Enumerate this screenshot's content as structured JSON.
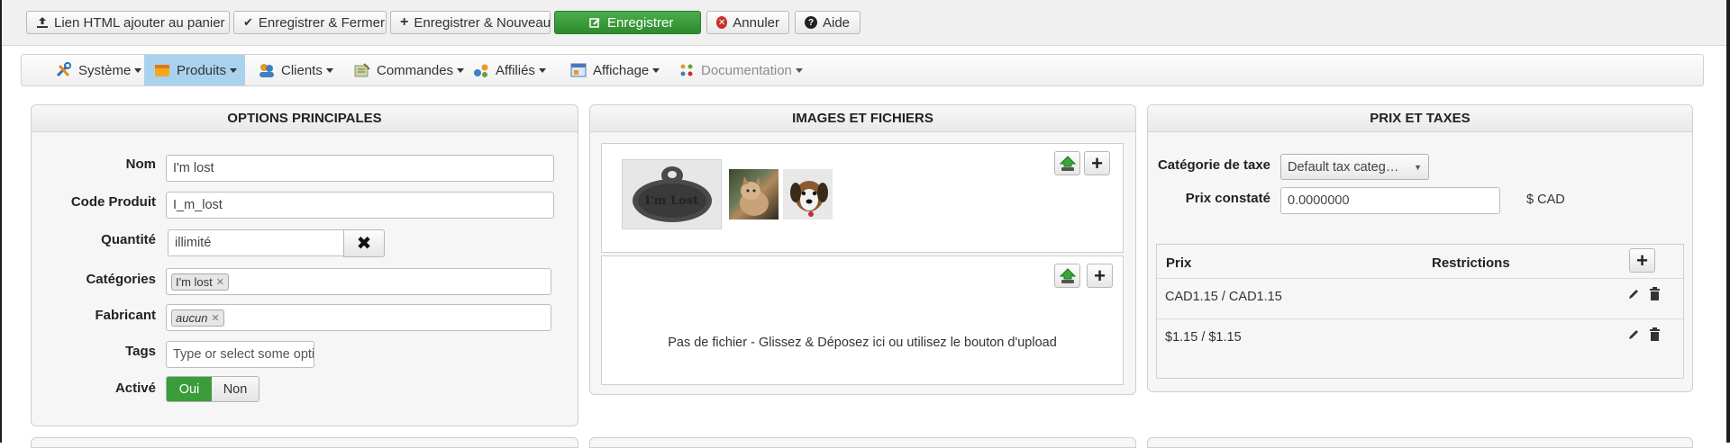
{
  "toolbar": {
    "link_html": "Lien HTML ajouter au panier",
    "save_close": "Enregistrer & Fermer",
    "save_new": "Enregistrer & Nouveau",
    "save": "Enregistrer",
    "cancel": "Annuler",
    "help": "Aide"
  },
  "nav": {
    "items": [
      {
        "label": "Système",
        "icon": "wrench-screwdriver-icon"
      },
      {
        "label": "Produits",
        "icon": "box-icon"
      },
      {
        "label": "Clients",
        "icon": "users-icon"
      },
      {
        "label": "Commandes",
        "icon": "orders-icon"
      },
      {
        "label": "Affiliés",
        "icon": "affiliates-icon"
      },
      {
        "label": "Affichage",
        "icon": "display-icon"
      },
      {
        "label": "Documentation",
        "icon": "documentation-icon"
      }
    ],
    "active_index": 1,
    "active_color": "#a9d2ef"
  },
  "main_options": {
    "title": "OPTIONS PRINCIPALES",
    "name_label": "Nom",
    "name_value": "I'm lost",
    "code_label": "Code Produit",
    "code_value": "I_m_lost",
    "quantity_label": "Quantité",
    "quantity_value": "illimité",
    "categories_label": "Catégories",
    "categories": [
      "I'm lost"
    ],
    "manufacturer_label": "Fabricant",
    "manufacturer": "aucun",
    "tags_label": "Tags",
    "tags_placeholder": "Type or select some opti",
    "active_label": "Activé",
    "active_yes": "Oui",
    "active_no": "Non",
    "active_state": "Oui"
  },
  "images": {
    "title": "IMAGES ET FICHIERS",
    "thumb_text": "I'm Lost",
    "files_empty": "Pas de fichier - Glissez & Déposez ici ou utilisez le bouton d'upload"
  },
  "prices": {
    "title": "PRIX ET TAXES",
    "tax_label": "Catégorie de taxe",
    "tax_value": "Default tax categ…",
    "msrp_label": "Prix constaté",
    "msrp_value": "0.0000000",
    "currency": "$ CAD",
    "table_headers": [
      "Prix",
      "Restrictions"
    ],
    "rows": [
      {
        "price": "CAD1.15 / CAD1.15"
      },
      {
        "price": "$1.15 / $1.15"
      }
    ]
  },
  "colors": {
    "success": "#3a9d3a",
    "danger": "#c9302c",
    "upload_green": "#3aa33a"
  }
}
